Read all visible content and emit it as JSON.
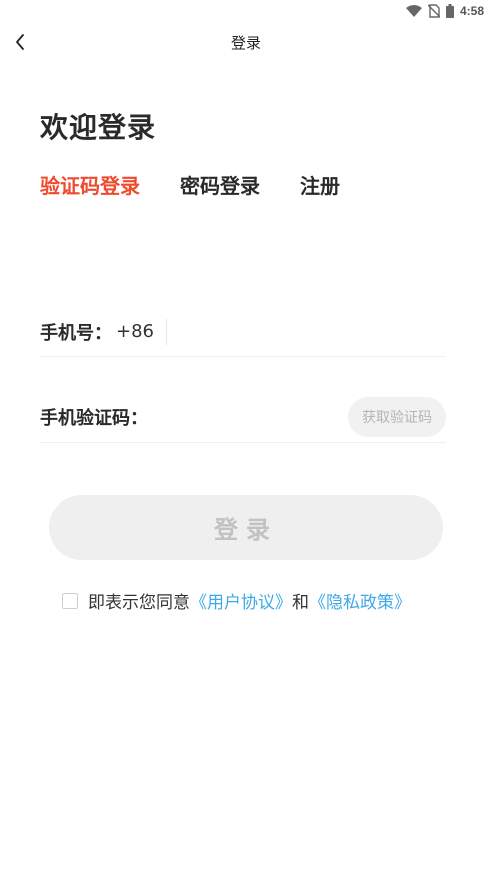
{
  "status_bar": {
    "time": "4:58",
    "icons": [
      "wifi-icon",
      "no-sim-icon",
      "battery-icon"
    ]
  },
  "nav": {
    "back_icon": "chevron-left-icon",
    "title": "登录"
  },
  "welcome": {
    "title": "欢迎登录"
  },
  "tabs": [
    {
      "label": "验证码登录",
      "active": true
    },
    {
      "label": "密码登录",
      "active": false
    },
    {
      "label": "注册",
      "active": false
    }
  ],
  "form": {
    "phone_label": "手机号：",
    "country_code": "+86",
    "phone_value": "",
    "code_label": "手机验证码：",
    "code_value": "",
    "get_code_label": "获取验证码"
  },
  "login_button": {
    "label": "登录"
  },
  "agreement": {
    "prefix": "即表示您同意",
    "user_agreement": "《用户协议》",
    "conjunction": "和",
    "privacy_policy": "《隐私政策》",
    "checked": false
  },
  "colors": {
    "accent": "#f04a2e",
    "link": "#3fa9e8",
    "disabled_bg": "#efefef",
    "disabled_text": "#c2c2c2"
  }
}
